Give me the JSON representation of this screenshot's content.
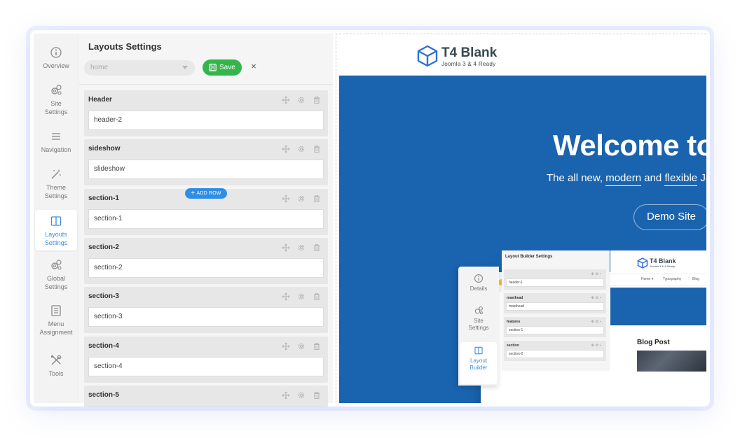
{
  "nav": {
    "items": [
      {
        "label": "Overview",
        "icon": "info-icon"
      },
      {
        "label": "Site Settings",
        "icon": "gears-icon"
      },
      {
        "label": "Navigation",
        "icon": "menu-icon"
      },
      {
        "label": "Theme Settings",
        "icon": "magic-wand-icon"
      },
      {
        "label": "Layouts Settings",
        "icon": "columns-icon",
        "active": true
      },
      {
        "label": "Global Settings",
        "icon": "gears-icon"
      },
      {
        "label": "Menu Assignment",
        "icon": "list-icon"
      },
      {
        "label": "Tools",
        "icon": "tools-icon"
      }
    ]
  },
  "panel": {
    "title": "Layouts Settings",
    "layout_select": "home",
    "save_label": "Save",
    "close_symbol": "×",
    "add_row_label": "ADD ROW",
    "blocks": [
      {
        "name": "Header",
        "value": "header-2"
      },
      {
        "name": "sideshow",
        "value": "slideshow"
      },
      {
        "name": "section-1",
        "value": "section-1"
      },
      {
        "name": "section-2",
        "value": "section-2"
      },
      {
        "name": "section-3",
        "value": "section-3"
      },
      {
        "name": "section-4",
        "value": "section-4"
      },
      {
        "name": "section-5",
        "value": ""
      }
    ]
  },
  "preview": {
    "logo_title": "T4 Blank",
    "logo_sub": "Joomla 3 & 4 Ready",
    "hero_title": "Welcome to",
    "hero_sub_1": "The all new, ",
    "hero_sub_2": "modern",
    "hero_sub_3": " and ",
    "hero_sub_4": "flexible",
    "hero_sub_5": " Jo",
    "demo_button": "Demo Site",
    "colors": {
      "hero": "#1a63ae",
      "save": "#33b54a",
      "accent": "#2d8ee6"
    },
    "mini": {
      "nav": [
        {
          "label": "Details",
          "icon": "info-icon"
        },
        {
          "label": "Site Settings",
          "icon": "gears-icon"
        },
        {
          "label": "Layout Builder",
          "icon": "columns-icon",
          "active": true
        }
      ],
      "panel_title": "Layout Builder Settings",
      "blocks": [
        {
          "name": "",
          "value": "header-1"
        },
        {
          "name": "masthead",
          "value": "masthead"
        },
        {
          "name": "features",
          "value": "section-1"
        },
        {
          "name": "section",
          "value": "section-2"
        }
      ],
      "logo_title": "T4 Blank",
      "logo_sub": "Joomla 3 & 4 Ready",
      "menu": [
        "Home ▾",
        "Typography",
        "Blog"
      ],
      "blog_title": "Blog Post"
    }
  }
}
